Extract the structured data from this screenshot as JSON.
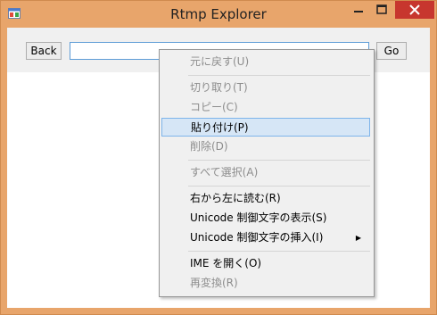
{
  "window": {
    "title": "Rtmp Explorer",
    "accent_color": "#e8a56b",
    "close_color": "#c7362e"
  },
  "toolbar": {
    "back_label": "Back",
    "url_value": "",
    "go_label": "Go"
  },
  "context_menu": {
    "items": [
      {
        "label": "元に戻す(U)",
        "enabled": false
      },
      {
        "label": "切り取り(T)",
        "enabled": false
      },
      {
        "label": "コピー(C)",
        "enabled": false
      },
      {
        "label": "貼り付け(P)",
        "enabled": true,
        "highlighted": true
      },
      {
        "label": "削除(D)",
        "enabled": false
      },
      {
        "label": "すべて選択(A)",
        "enabled": false
      },
      {
        "label": "右から左に読む(R)",
        "enabled": true
      },
      {
        "label": "Unicode 制御文字の表示(S)",
        "enabled": true
      },
      {
        "label": "Unicode 制御文字の挿入(I)",
        "enabled": true,
        "submenu": true
      },
      {
        "label": "IME を開く(O)",
        "enabled": true
      },
      {
        "label": "再変換(R)",
        "enabled": false
      }
    ]
  }
}
